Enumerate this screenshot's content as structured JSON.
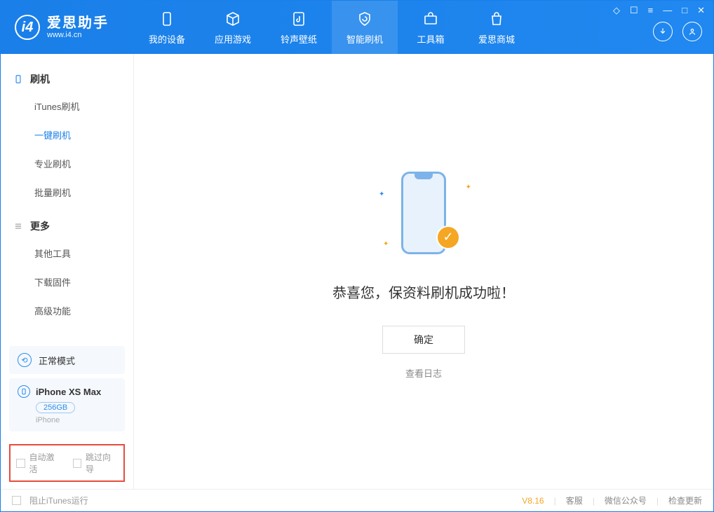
{
  "app": {
    "title": "爱思助手",
    "subtitle": "www.i4.cn"
  },
  "nav": {
    "items": [
      {
        "label": "我的设备"
      },
      {
        "label": "应用游戏"
      },
      {
        "label": "铃声壁纸"
      },
      {
        "label": "智能刷机"
      },
      {
        "label": "工具箱"
      },
      {
        "label": "爱思商城"
      }
    ],
    "active_index": 3
  },
  "sidebar": {
    "sections": [
      {
        "title": "刷机",
        "items": [
          "iTunes刷机",
          "一键刷机",
          "专业刷机",
          "批量刷机"
        ],
        "active_index": 1
      },
      {
        "title": "更多",
        "items": [
          "其他工具",
          "下载固件",
          "高级功能"
        ],
        "active_index": -1
      }
    ],
    "status": {
      "label": "正常模式"
    },
    "device": {
      "name": "iPhone XS Max",
      "storage": "256GB",
      "type": "iPhone"
    },
    "options": {
      "auto_activate": "自动激活",
      "skip_guide": "跳过向导"
    }
  },
  "main": {
    "success_message": "恭喜您，保资料刷机成功啦！",
    "ok_button": "确定",
    "view_log": "查看日志"
  },
  "statusbar": {
    "block_itunes": "阻止iTunes运行",
    "version": "V8.16",
    "links": [
      "客服",
      "微信公众号",
      "检查更新"
    ]
  }
}
